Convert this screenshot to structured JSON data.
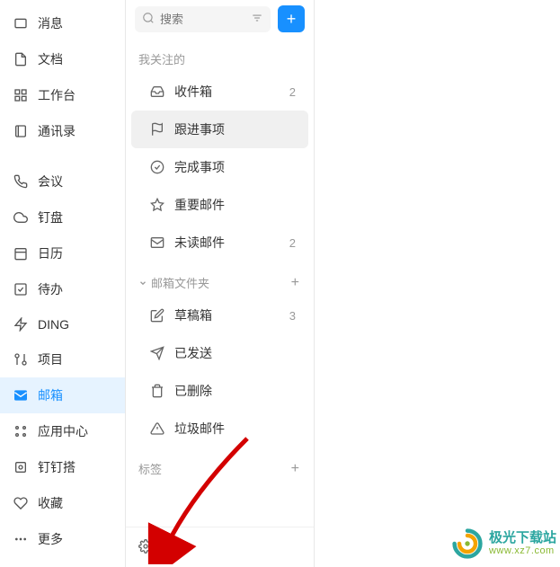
{
  "search": {
    "placeholder": "搜索"
  },
  "nav": {
    "messages": "消息",
    "documents": "文档",
    "workspace": "工作台",
    "contacts": "通讯录",
    "meetings": "会议",
    "drive": "钉盘",
    "calendar": "日历",
    "todo": "待办",
    "ding": "DING",
    "projects": "项目",
    "mail": "邮箱",
    "appcenter": "应用中心",
    "dingdingda": "钉钉搭",
    "favorites": "收藏",
    "more": "更多"
  },
  "sections": {
    "following": "我关注的",
    "folders": "邮箱文件夹",
    "tags": "标签"
  },
  "folders": {
    "inbox": {
      "label": "收件箱",
      "count": "2"
    },
    "followup": {
      "label": "跟进事项"
    },
    "done": {
      "label": "完成事项"
    },
    "important": {
      "label": "重要邮件"
    },
    "unread": {
      "label": "未读邮件",
      "count": "2"
    },
    "drafts": {
      "label": "草稿箱",
      "count": "3"
    },
    "sent": {
      "label": "已发送"
    },
    "trash": {
      "label": "已删除"
    },
    "spam": {
      "label": "垃圾邮件"
    }
  },
  "settings": "设置",
  "watermark": {
    "title": "极光下载站",
    "sub": "www.xz7.com"
  }
}
